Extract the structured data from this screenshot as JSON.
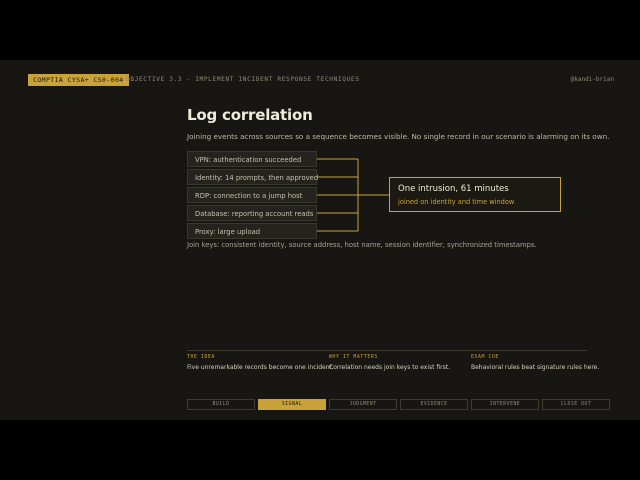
{
  "header": {
    "badge": "COMPTIA CYSA+ CS0-004",
    "objective": "OBJECTIVE 3.3 - IMPLEMENT INCIDENT RESPONSE TECHNIQUES",
    "handle": "@kandi-brian"
  },
  "slide": {
    "title": "Log correlation",
    "subtitle": "Joining events across sources so a sequence becomes visible. No single record in our scenario is alarming on its own.",
    "events": [
      "VPN: authentication succeeded",
      "Identity: 14 prompts, then approved",
      "RDP: connection to a jump host",
      "Database: reporting account reads",
      "Proxy: large upload"
    ],
    "result": {
      "title": "One intrusion, 61 minutes",
      "subtitle": "joined on identity and time window"
    },
    "join_keys": "Join keys: consistent identity, source address, host name, session identifier, synchronized timestamps."
  },
  "info": [
    {
      "heading": "THE IDEA",
      "text": "Five unremarkable records become one incident."
    },
    {
      "heading": "WHY IT MATTERS",
      "text": "Correlation needs join keys to exist first."
    },
    {
      "heading": "EXAM CUE",
      "text": "Behavioral rules beat signature rules here."
    }
  ],
  "nav": {
    "items": [
      "BUILD",
      "SIGNAL",
      "JUDGMENT",
      "EVIDENCE",
      "INTERVENE",
      "CLOSE OUT"
    ],
    "active": "SIGNAL"
  },
  "colors": {
    "accent": "#c9a23a",
    "background": "#171612",
    "text": "#f0ebdc"
  }
}
